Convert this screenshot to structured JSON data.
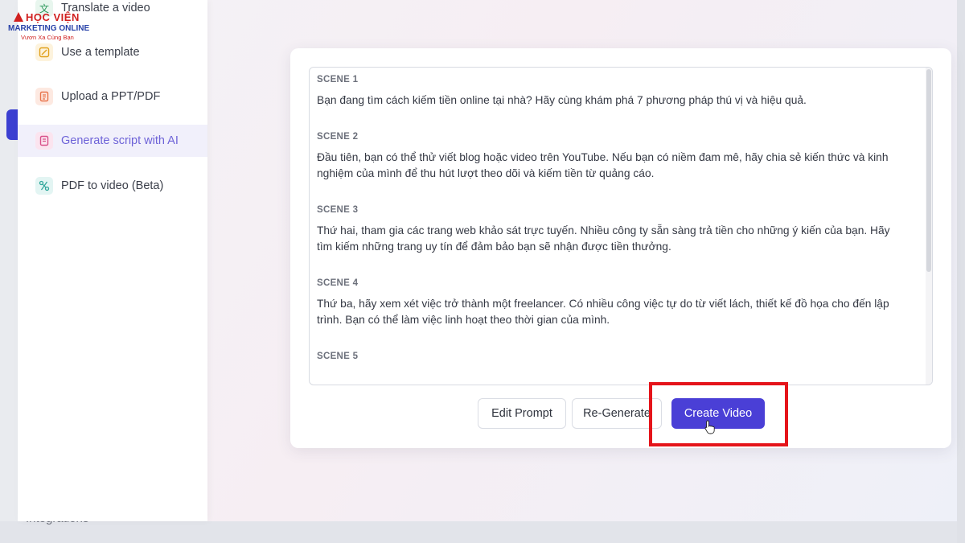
{
  "sidebar": {
    "items": [
      {
        "label": "Translate a video",
        "icon": "translate-icon"
      },
      {
        "label": "Use a template",
        "icon": "template-icon"
      },
      {
        "label": "Upload a PPT/PDF",
        "icon": "document-icon"
      },
      {
        "label": "Generate script with AI",
        "icon": "ai-script-icon",
        "active": true
      },
      {
        "label": "PDF to video (Beta)",
        "icon": "pdf-video-icon"
      }
    ]
  },
  "background": {
    "integrations_label": "Integrations"
  },
  "logo": {
    "title": "HỌC VIỆN",
    "subtitle": "MARKETING ONLINE",
    "tagline": "Vươn Xa Cùng Bạn"
  },
  "script": {
    "scenes": [
      {
        "label": "SCENE 1",
        "text": "Bạn đang tìm cách kiếm tiền online tại nhà? Hãy cùng khám phá 7 phương pháp thú vị và hiệu quả."
      },
      {
        "label": "SCENE 2",
        "text": "Đầu tiên, bạn có thể thử viết blog hoặc video trên YouTube. Nếu bạn có niềm đam mê, hãy chia sẻ kiến thức và kinh nghiệm của mình để thu hút lượt theo dõi và kiếm tiền từ quảng cáo."
      },
      {
        "label": "SCENE 3",
        "text": "Thứ hai, tham gia các trang web khảo sát trực tuyến. Nhiều công ty sẵn sàng trả tiền cho những ý kiến của bạn. Hãy tìm kiếm những trang uy tín để đảm bảo bạn sẽ nhận được tiền thưởng."
      },
      {
        "label": "SCENE 4",
        "text": "Thứ ba, hãy xem xét việc trở thành một freelancer. Có nhiều công việc tự do từ viết lách, thiết kế đồ họa cho đến lập trình. Bạn có thể làm việc linh hoạt theo thời gian của mình."
      },
      {
        "label": "SCENE 5",
        "text": ""
      }
    ]
  },
  "actions": {
    "edit_prompt": "Edit Prompt",
    "regenerate": "Re-Generate",
    "create_video": "Create Video"
  },
  "colors": {
    "primary": "#4a3fd6",
    "highlight": "#e5141a",
    "active_menu_text": "#6e63d8"
  }
}
